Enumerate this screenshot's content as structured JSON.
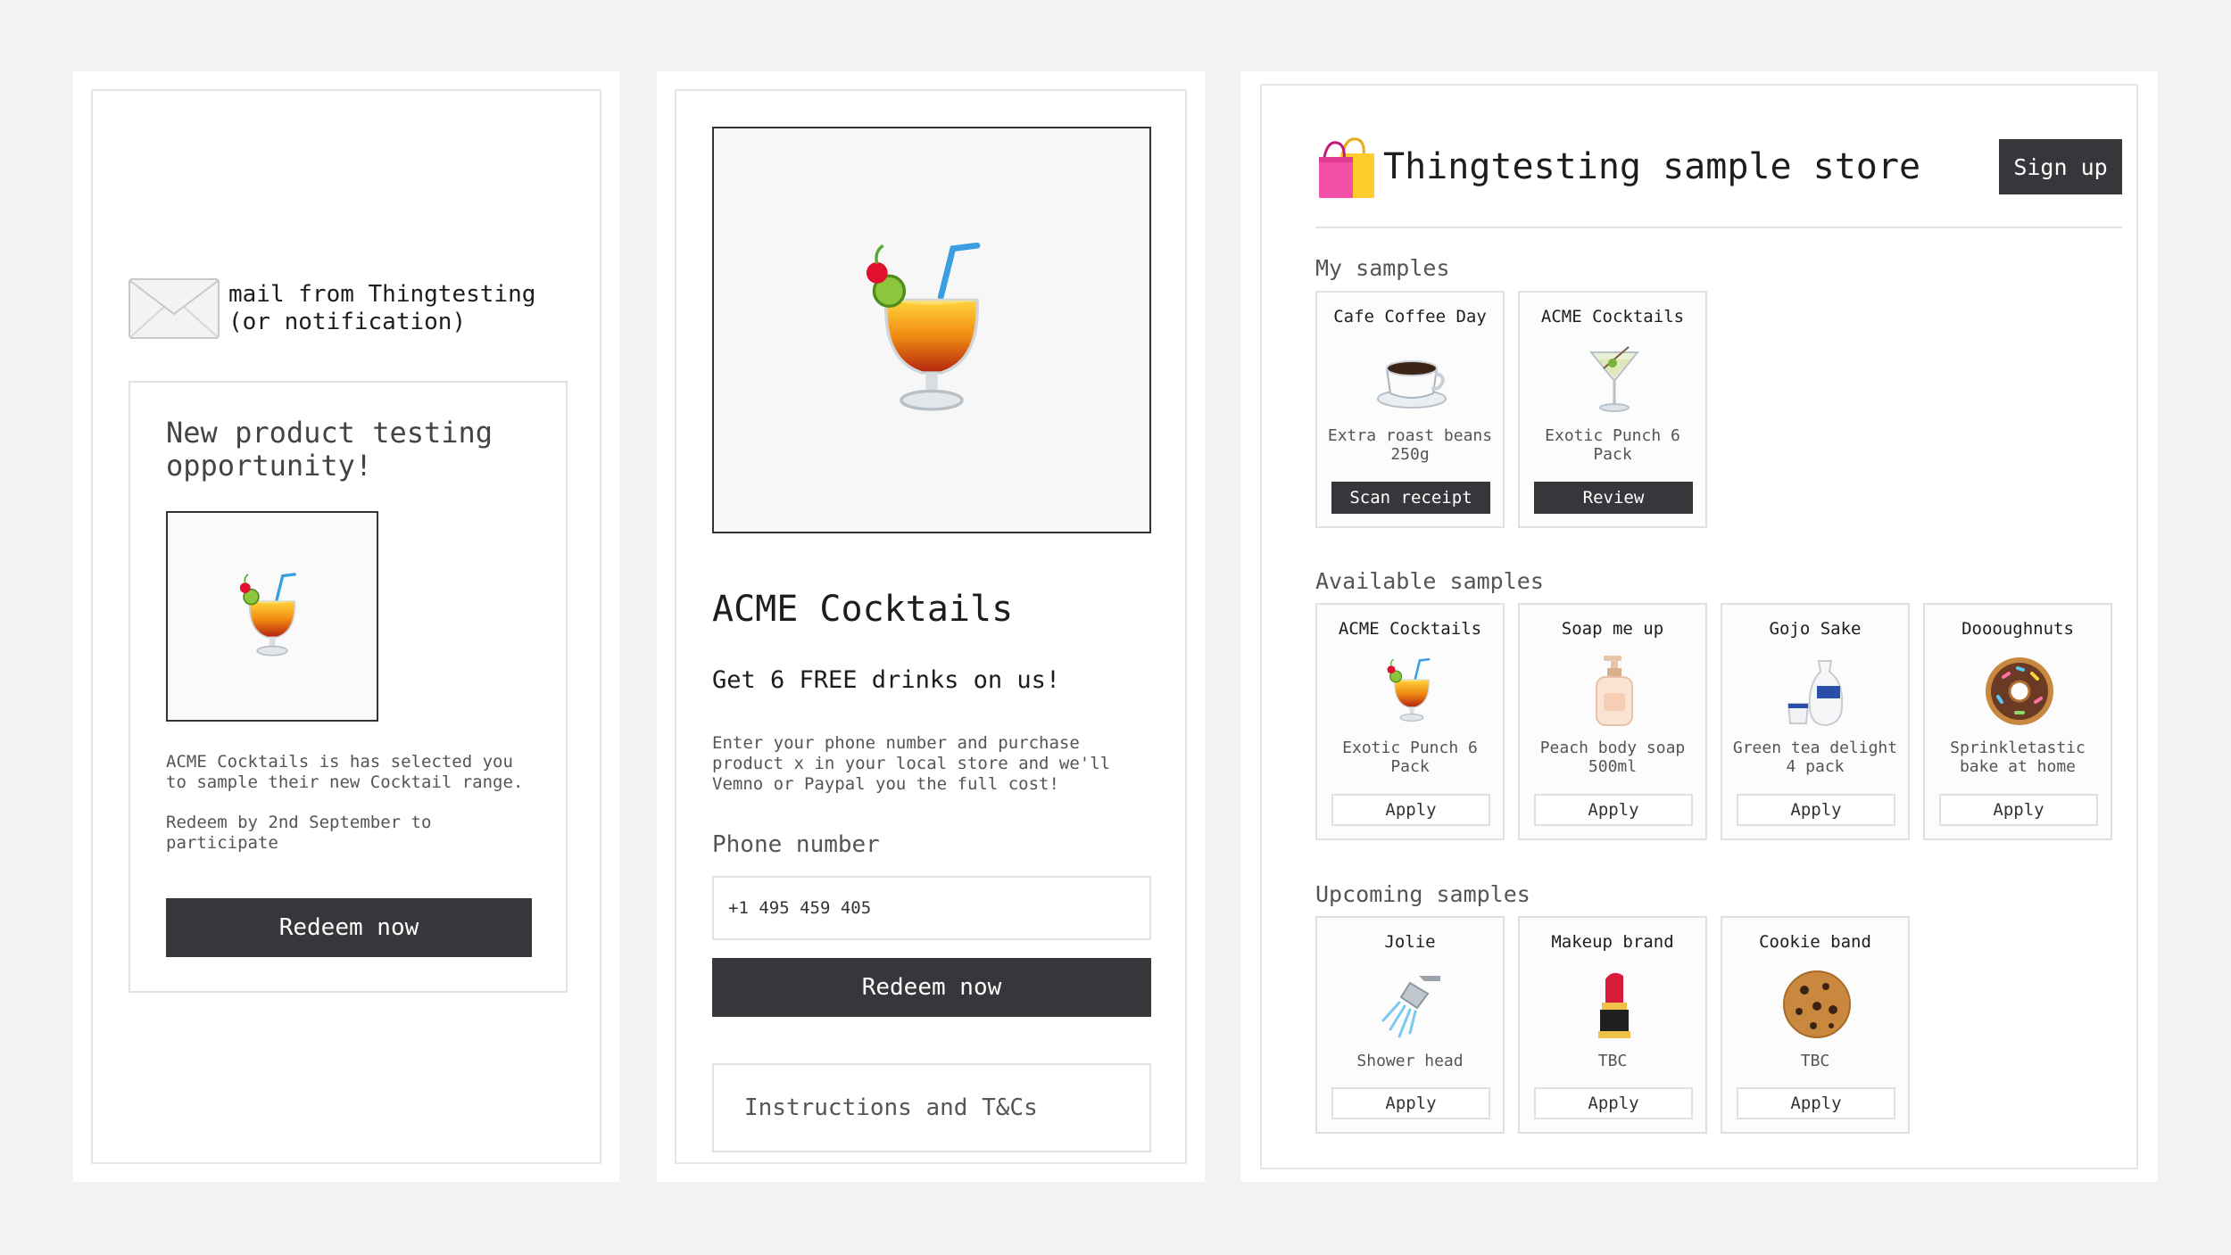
{
  "email": {
    "sender_line1": "mail from Thingtesting",
    "sender_line2": "(or notification)",
    "title": "New product testing opportunity!",
    "body1": "ACME Cocktails is has selected you to sample their new Cocktail range.",
    "body2": "Redeem by 2nd September to participate",
    "button": "Redeem now"
  },
  "landing": {
    "brand": "ACME Cocktails",
    "offer": "Get 6 FREE drinks on us!",
    "description": "Enter your phone number and purchase product x in your local store and we'll Vemno or Paypal you the full cost!",
    "phone_label": "Phone number",
    "phone_value": "+1 495 459 405",
    "button": "Redeem now",
    "terms": "Instructions and T&Cs"
  },
  "store": {
    "title": "Thingtesting sample store",
    "signup": "Sign up",
    "my_samples_title": "My samples",
    "my_samples": [
      {
        "brand": "Cafe Coffee Day",
        "product": "Extra roast beans 250g",
        "action": "Scan receipt",
        "icon": "coffee-cup-icon"
      },
      {
        "brand": "ACME Cocktails",
        "product": "Exotic Punch 6 Pack",
        "action": "Review",
        "icon": "martini-icon"
      }
    ],
    "available_title": "Available samples",
    "available": [
      {
        "brand": "ACME Cocktails",
        "product": "Exotic Punch 6 Pack",
        "action": "Apply",
        "icon": "cocktail-icon"
      },
      {
        "brand": "Soap me up",
        "product": "Peach body soap 500ml",
        "action": "Apply",
        "icon": "lotion-bottle-icon"
      },
      {
        "brand": "Gojo Sake",
        "product": "Green tea delight 4 pack",
        "action": "Apply",
        "icon": "sake-icon"
      },
      {
        "brand": "Doooughnuts",
        "product": "Sprinkletastic bake at home",
        "action": "Apply",
        "icon": "doughnut-icon"
      }
    ],
    "upcoming_title": "Upcoming samples",
    "upcoming": [
      {
        "brand": "Jolie",
        "product": "Shower head",
        "action": "Apply",
        "icon": "shower-head-icon"
      },
      {
        "brand": "Makeup brand",
        "product": "TBC",
        "action": "Apply",
        "icon": "lipstick-icon"
      },
      {
        "brand": "Cookie band",
        "product": "TBC",
        "action": "Apply",
        "icon": "cookie-icon"
      }
    ]
  }
}
